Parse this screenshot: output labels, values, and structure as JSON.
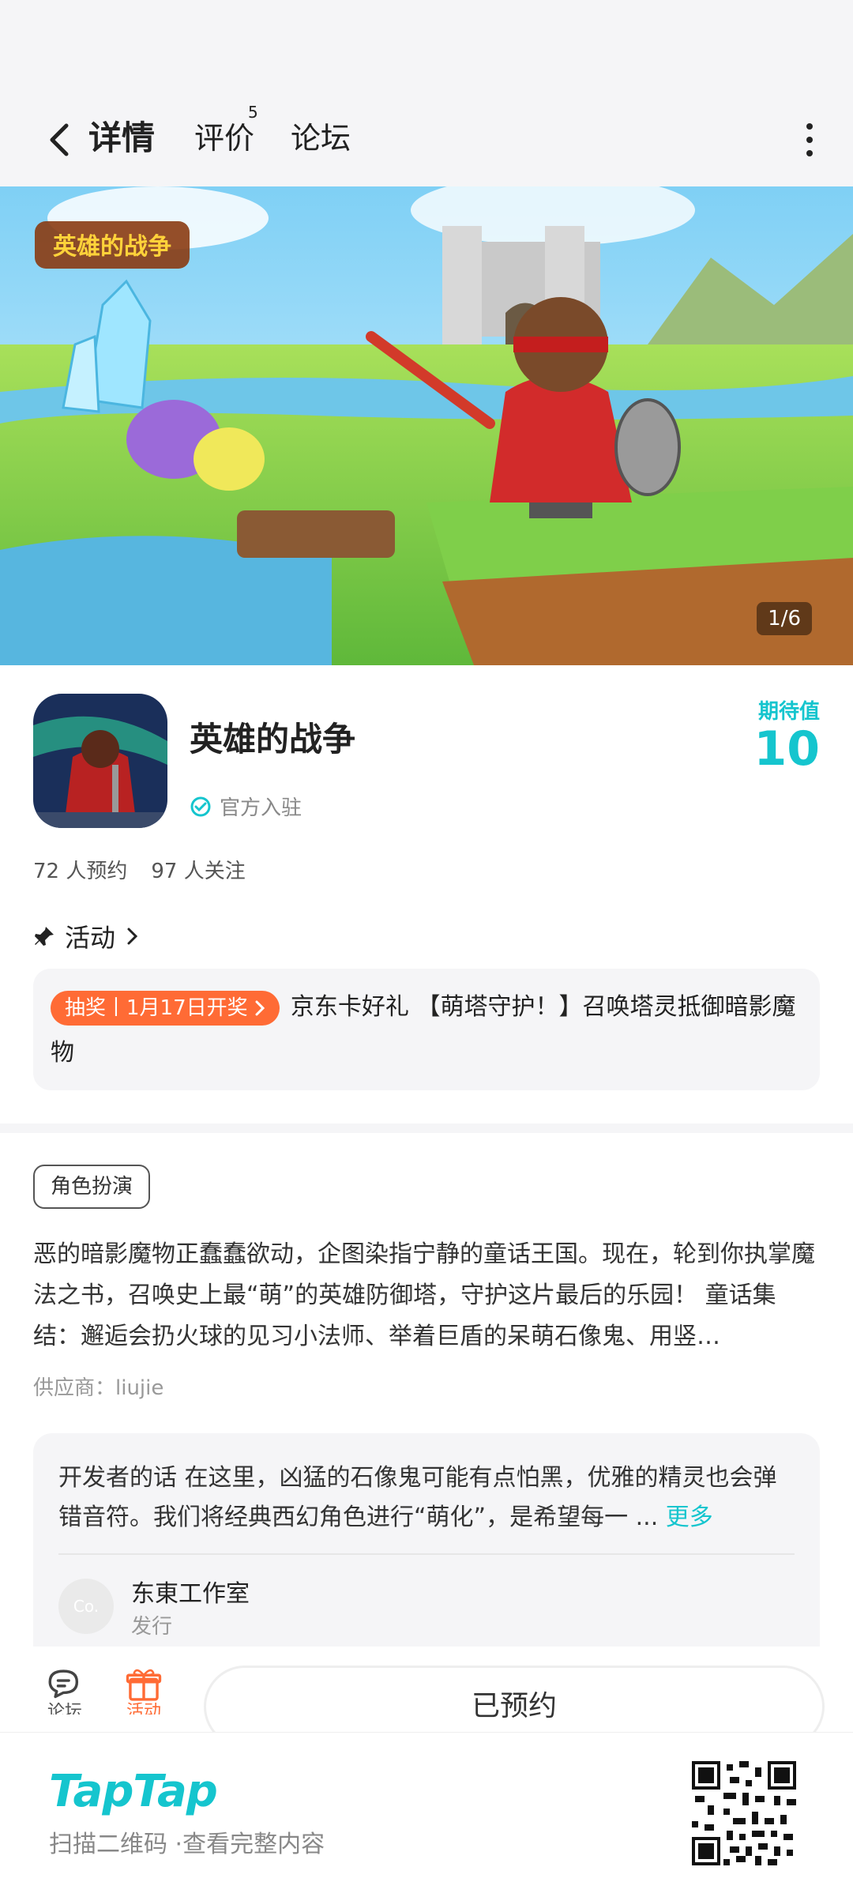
{
  "header": {
    "tabs": [
      {
        "label": "详情",
        "active": true
      },
      {
        "label": "评价",
        "badge": "5"
      },
      {
        "label": "论坛"
      }
    ]
  },
  "banner": {
    "counter": "1/6",
    "game_logo_text": "英雄的战争"
  },
  "game": {
    "title": "英雄的战争",
    "official_label": "官方入驻",
    "expect_label": "期待值",
    "expect_value": "10",
    "reservations": "72 人预约",
    "followers": "97 人关注"
  },
  "activity": {
    "heading": "活动",
    "badge": "抽奖丨1月17日开奖",
    "text": "京东卡好礼 【萌塔守护！】召唤塔灵抵御暗影魔物"
  },
  "description": {
    "genre_tag": "角色扮演",
    "text": "恶的暗影魔物正蠢蠢欲动，企图染指宁静的童话王国。现在，轮到你执掌魔法之书，召唤史上最“萌”的英雄防御塔，守护这片最后的乐园！ 童话集结：邂逅会扔火球的见习小法师、举着巨盾的呆萌石像鬼、用竖…",
    "supplier": "供应商：liujie"
  },
  "developer": {
    "text": "开发者的话  在这里，凶猛的石像鬼可能有点怕黑，优雅的精灵也会弹错音符。我们将经典西幻角色进行“萌化”，是希望每一 ...",
    "more": "更多",
    "publisher_name": "东東工作室",
    "publisher_role": "发行",
    "avatar_text": "Co."
  },
  "bottom_bar": {
    "forum_label": "论坛",
    "activity_label": "活动",
    "reserved_button": "已预约"
  },
  "footer": {
    "logo": "TapTap",
    "text": "扫描二维码 ·查看完整内容"
  },
  "colors": {
    "accent": "#15c5ce",
    "lottery": "#ff6b35"
  }
}
